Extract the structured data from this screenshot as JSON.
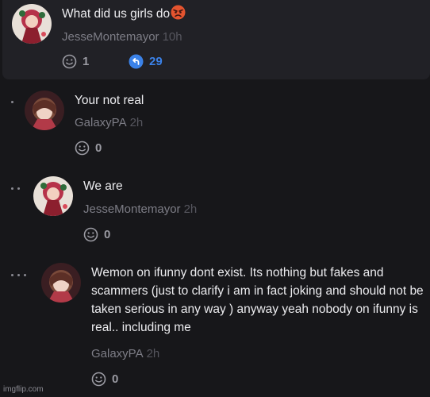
{
  "comments": [
    {
      "text": "What did us girls do",
      "emoji": "angry-face",
      "author": "JesseMontemayor",
      "time": "10h",
      "smiles": "1",
      "replies": "29",
      "colors": {
        "reply_accent": "#3b82e8"
      }
    },
    {
      "text": "Your not real",
      "author": "GalaxyPA",
      "time": "2h",
      "smiles": "0"
    },
    {
      "text": "We are",
      "author": "JesseMontemayor",
      "time": "2h",
      "smiles": "0"
    },
    {
      "text": "Wemon on ifunny dont exist. Its nothing but fakes and scammers (just to clarify i am in fact joking and should not be taken serious in any way ) anyway yeah nobody on ifunny is real.. including me",
      "author": "GalaxyPA",
      "time": "2h",
      "smiles": "0"
    }
  ],
  "icons": {
    "smile": "smile-icon",
    "reply": "reply-arrow-icon",
    "thread_dot": "thread-dot-icon"
  },
  "watermark": "imgflip.com"
}
